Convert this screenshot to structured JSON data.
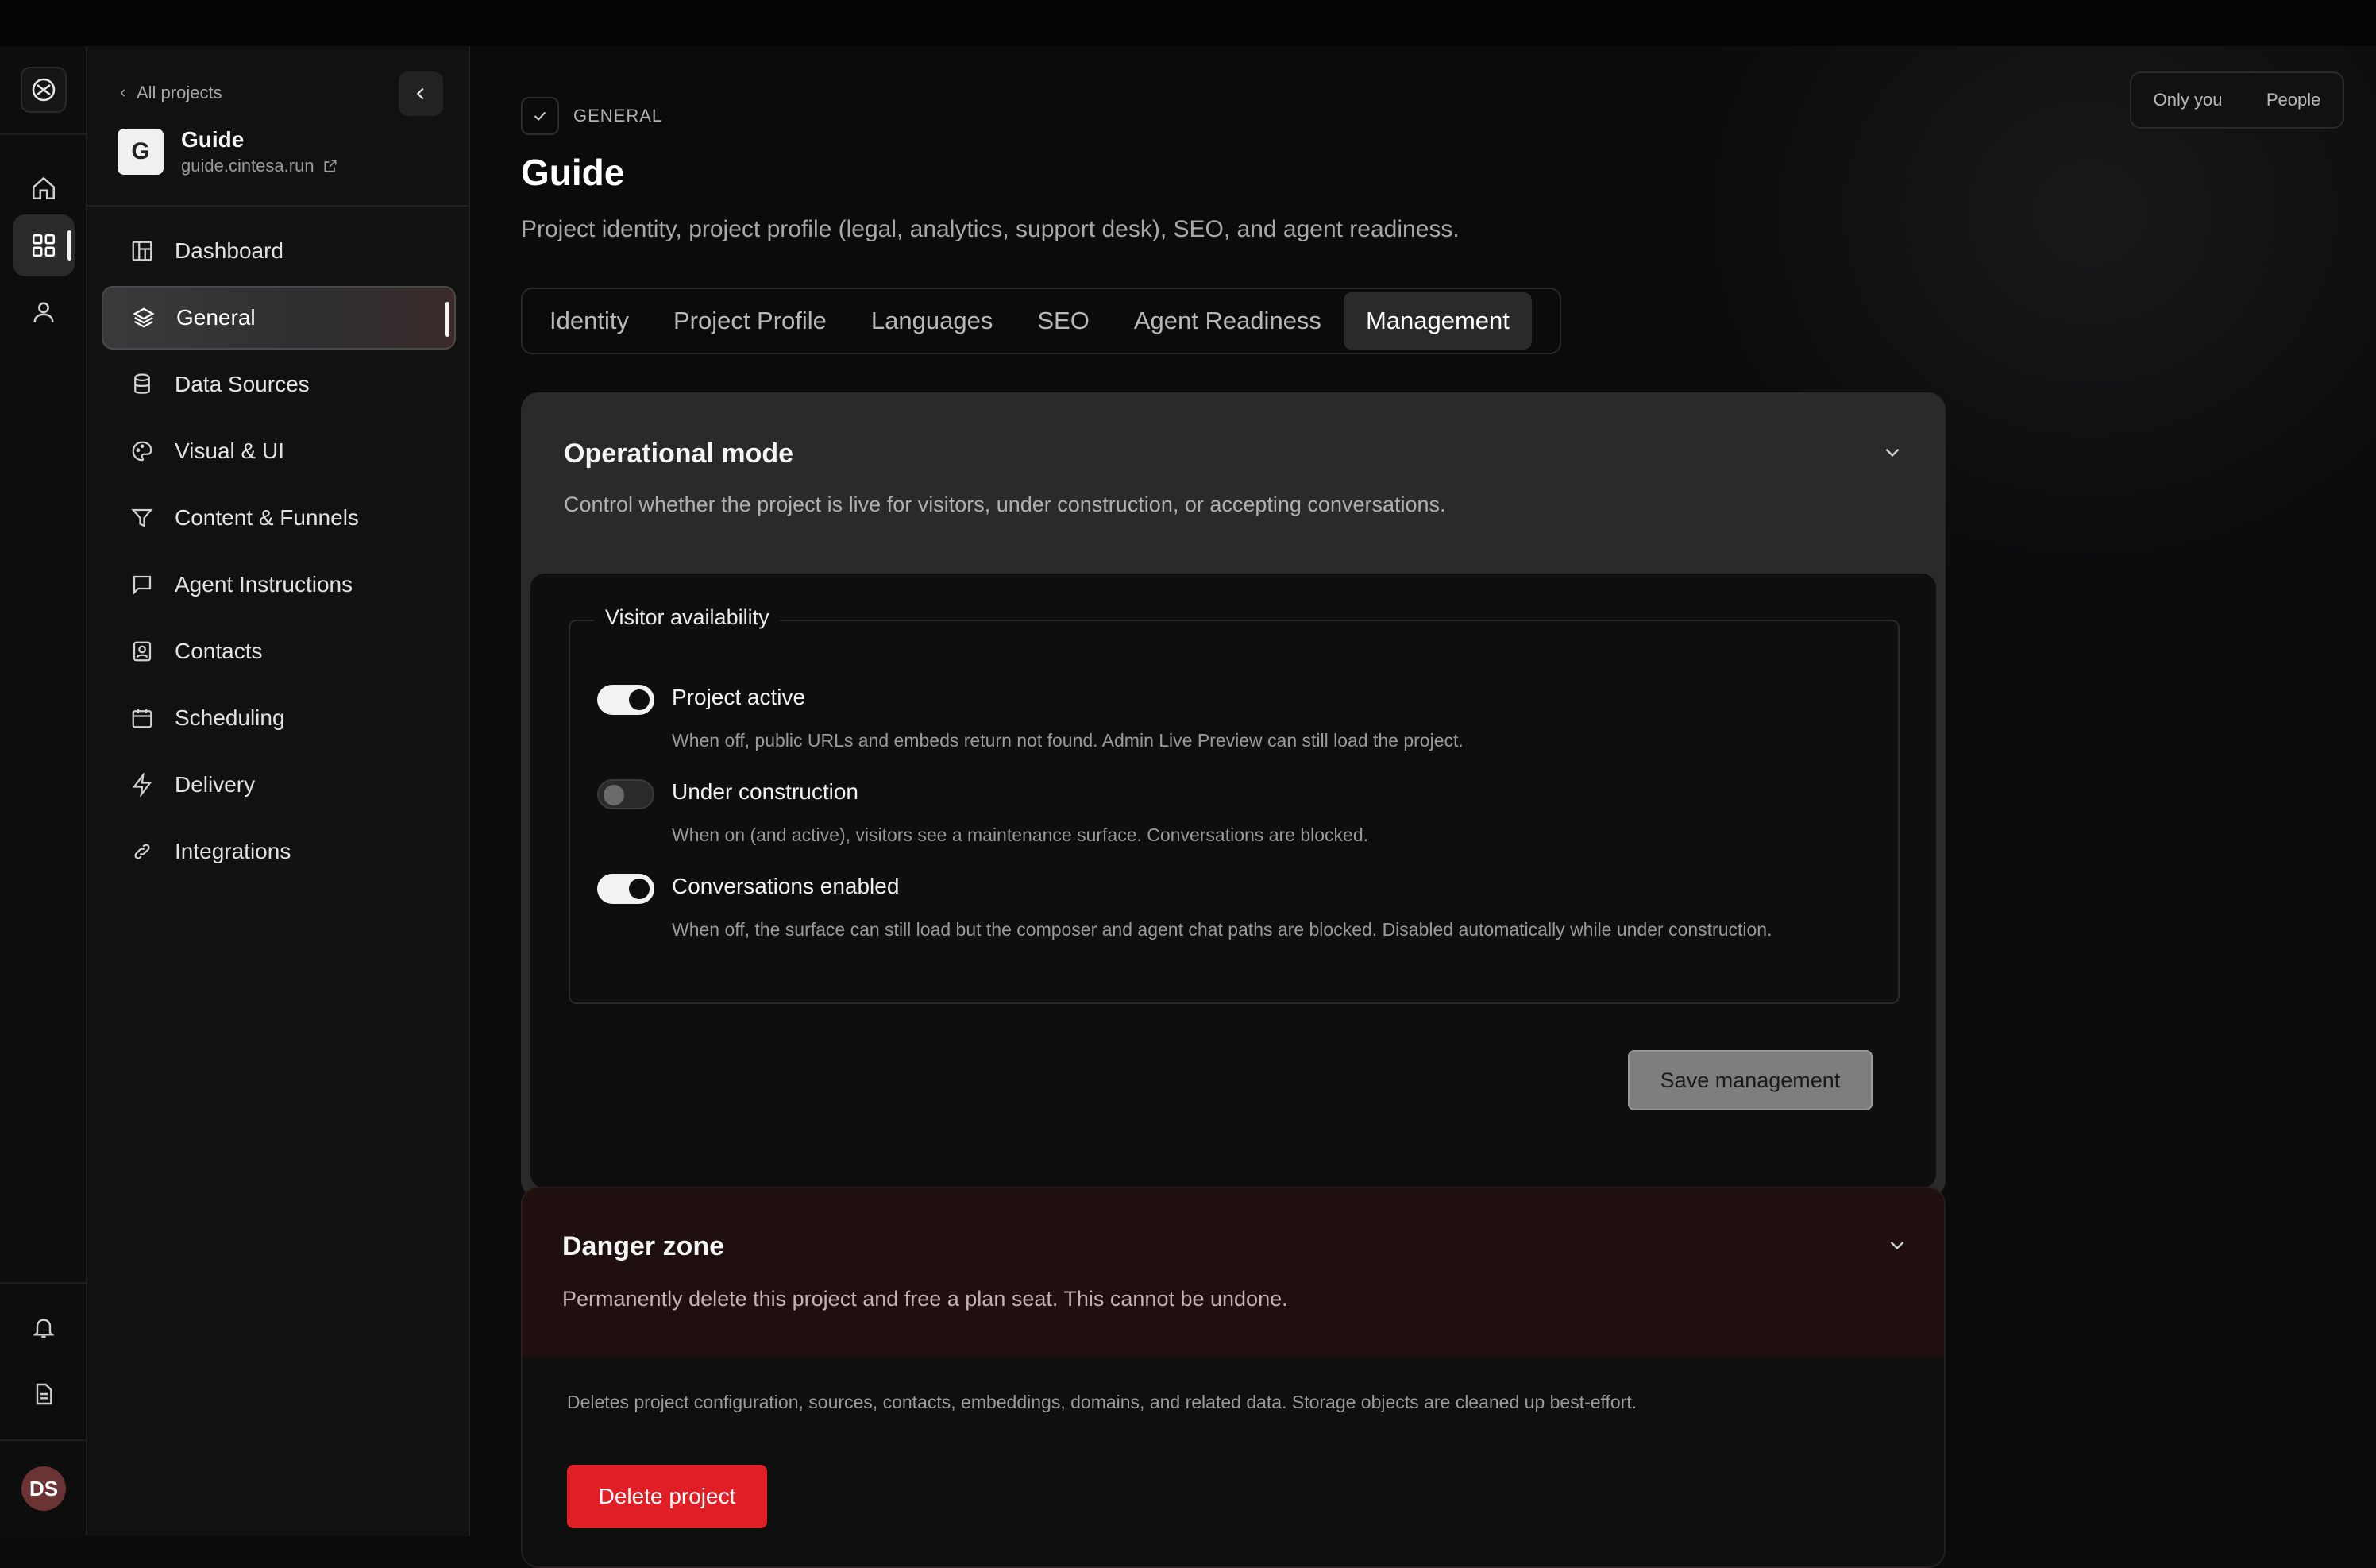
{
  "rail": {
    "avatar_initials": "DS",
    "icons": [
      "app-logo-icon",
      "home-icon",
      "grid-icon",
      "user-icon",
      "bell-icon",
      "document-icon"
    ]
  },
  "sidebar": {
    "back_label": "All projects",
    "project": {
      "name": "Guide",
      "url": "guide.cintesa.run",
      "thumb_letter": "G"
    },
    "items": [
      {
        "label": "Dashboard",
        "icon": "dashboard-icon"
      },
      {
        "label": "General",
        "icon": "layers-icon",
        "active": true
      },
      {
        "label": "Data Sources",
        "icon": "database-icon"
      },
      {
        "label": "Visual & UI",
        "icon": "palette-icon"
      },
      {
        "label": "Content & Funnels",
        "icon": "funnel-icon"
      },
      {
        "label": "Agent Instructions",
        "icon": "chat-icon"
      },
      {
        "label": "Contacts",
        "icon": "contact-icon"
      },
      {
        "label": "Scheduling",
        "icon": "calendar-icon"
      },
      {
        "label": "Delivery",
        "icon": "bolt-icon"
      },
      {
        "label": "Integrations",
        "icon": "link-icon"
      }
    ]
  },
  "visibility": {
    "only_you": "Only you",
    "people": "People"
  },
  "header": {
    "breadcrumb": "GENERAL",
    "title": "Guide",
    "description": "Project identity, project profile (legal, analytics, support desk), SEO, and agent readiness."
  },
  "tabs": [
    {
      "label": "Identity"
    },
    {
      "label": "Project Profile"
    },
    {
      "label": "Languages"
    },
    {
      "label": "SEO"
    },
    {
      "label": "Agent Readiness"
    },
    {
      "label": "Management",
      "active": true
    }
  ],
  "operational": {
    "title": "Operational mode",
    "description": "Control whether the project is live for visitors, under construction, or accepting conversations.",
    "legend": "Visitor availability",
    "toggles": [
      {
        "label": "Project active",
        "on": true,
        "help": "When off, public URLs and embeds return not found. Admin Live Preview can still load the project."
      },
      {
        "label": "Under construction",
        "on": false,
        "help": "When on (and active), visitors see a maintenance surface. Conversations are blocked."
      },
      {
        "label": "Conversations enabled",
        "on": true,
        "help": "When off, the surface can still load but the composer and agent chat paths are blocked. Disabled automatically while under construction."
      }
    ],
    "save_label": "Save management"
  },
  "danger": {
    "title": "Danger zone",
    "description": "Permanently delete this project and free a plan seat. This cannot be undone.",
    "note": "Deletes project configuration, sources, contacts, embeddings, domains, and related data. Storage objects are cleaned up best-effort.",
    "delete_label": "Delete project"
  },
  "colors": {
    "background": "#0b0b0c",
    "danger_red": "#e01e26",
    "card": "#2a2a2b"
  }
}
